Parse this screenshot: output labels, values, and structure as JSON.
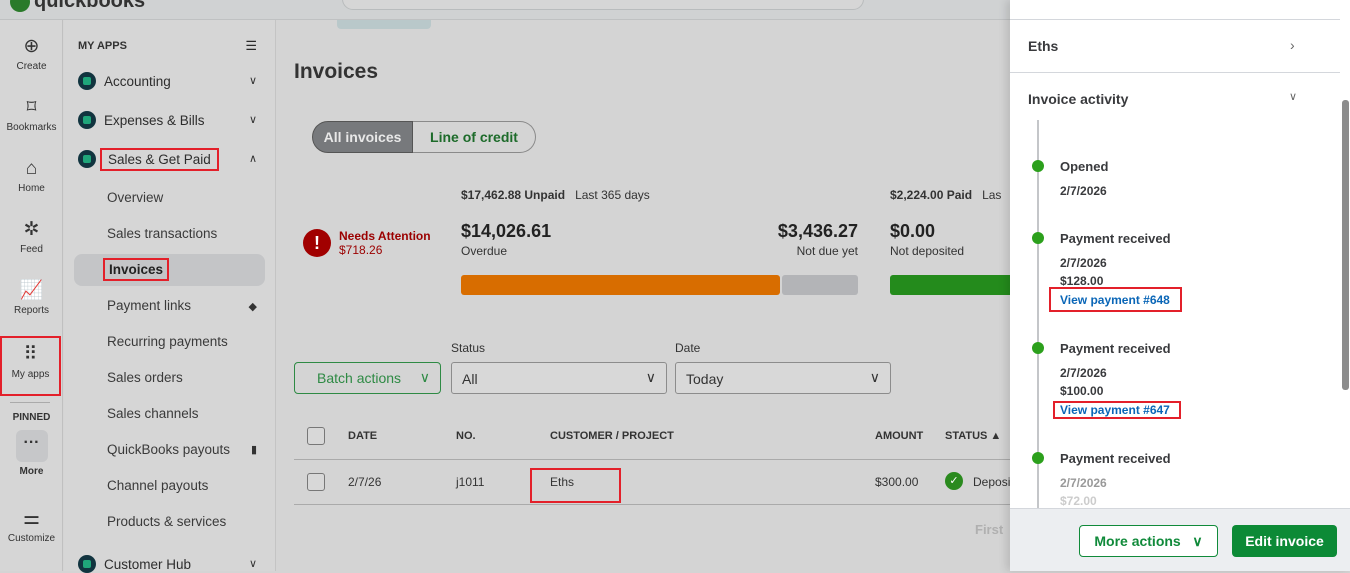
{
  "app": {
    "logo": "quickbooks"
  },
  "rail": [
    {
      "label": "Create",
      "icon": "plus-circle-icon"
    },
    {
      "label": "Bookmarks",
      "icon": "bookmark-icon"
    },
    {
      "label": "Home",
      "icon": "home-icon"
    },
    {
      "label": "Feed",
      "icon": "feed-icon"
    },
    {
      "label": "Reports",
      "icon": "reports-icon"
    },
    {
      "label": "My apps",
      "icon": "grid-icon"
    }
  ],
  "rail_pinned": "PINNED",
  "rail_more": "More",
  "rail_customize": "Customize",
  "nav": {
    "header": "MY APPS",
    "apps": [
      "Accounting",
      "Expenses & Bills",
      "Sales & Get Paid",
      "Customer Hub"
    ],
    "sub": [
      "Overview",
      "Sales transactions",
      "Invoices",
      "Payment links",
      "Recurring payments",
      "Sales orders",
      "Sales channels",
      "QuickBooks payouts",
      "Channel payouts",
      "Products & services"
    ]
  },
  "main": {
    "title": "Invoices",
    "tabs": [
      "All invoices",
      "Line of credit"
    ],
    "attention": {
      "label": "Needs Attention",
      "amount": "$718.26"
    },
    "unpaid": {
      "total": "$17,462.88 Unpaid",
      "period": "Last 365 days",
      "overdue": "$14,026.61",
      "overdue_label": "Overdue",
      "notdue": "$3,436.27",
      "notdue_label": "Not due yet",
      "overdue_fraction": 0.803
    },
    "paid": {
      "total": "$2,224.00 Paid",
      "period": "Las",
      "notdep": "$0.00",
      "notdep_label": "Not deposited"
    },
    "batch": "Batch actions",
    "status_label": "Status",
    "status_value": "All",
    "date_label": "Date",
    "date_value": "Today",
    "columns": [
      "DATE",
      "NO.",
      "CUSTOMER / PROJECT",
      "AMOUNT",
      "STATUS ▲"
    ],
    "rows": [
      {
        "date": "2/7/26",
        "no": "j1011",
        "customer": "Eths",
        "amount": "$300.00",
        "status": "Deposi"
      }
    ],
    "pager": "First"
  },
  "panel": {
    "customer": "Eths",
    "activity_title": "Invoice activity",
    "events": [
      {
        "title": "Opened",
        "date": "2/7/2026"
      },
      {
        "title": "Payment received",
        "date": "2/7/2026",
        "amount": "$128.00",
        "link": "View payment #648"
      },
      {
        "title": "Payment received",
        "date": "2/7/2026",
        "amount": "$100.00",
        "link": "View payment #647"
      },
      {
        "title": "Payment received",
        "date": "2/7/2026",
        "amount": "$72.00"
      }
    ],
    "more_actions": "More actions",
    "edit": "Edit invoice"
  }
}
